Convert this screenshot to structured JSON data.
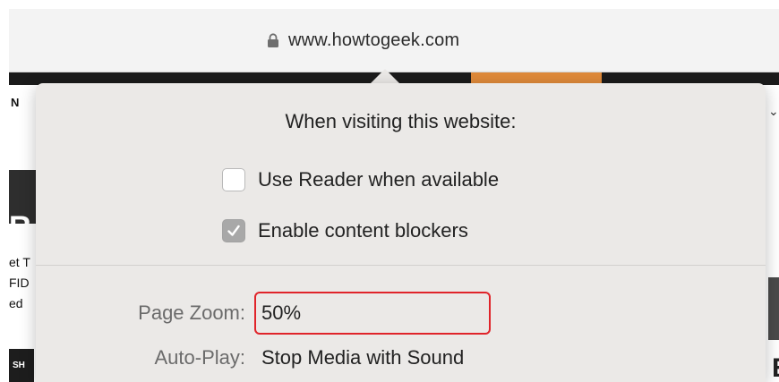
{
  "browser": {
    "url": "www.howtogeek.com",
    "lock_icon": "lock-icon"
  },
  "background_page": {
    "nav_fragment": "N",
    "left_logo": "R",
    "left_lines": [
      "et T",
      "FID",
      "ed"
    ],
    "left_button": "SH",
    "right_fragment": "E"
  },
  "popover": {
    "title": "When visiting this website:",
    "options": [
      {
        "label": "Use Reader when available",
        "checked": false
      },
      {
        "label": "Enable content blockers",
        "checked": true
      }
    ],
    "settings": [
      {
        "label": "Page Zoom:",
        "value": "50%",
        "highlighted": true
      },
      {
        "label": "Auto-Play:",
        "value": "Stop Media with Sound",
        "highlighted": false
      }
    ]
  },
  "colors": {
    "highlight": "#e0242a",
    "accent_orange": "#e08a3a"
  }
}
